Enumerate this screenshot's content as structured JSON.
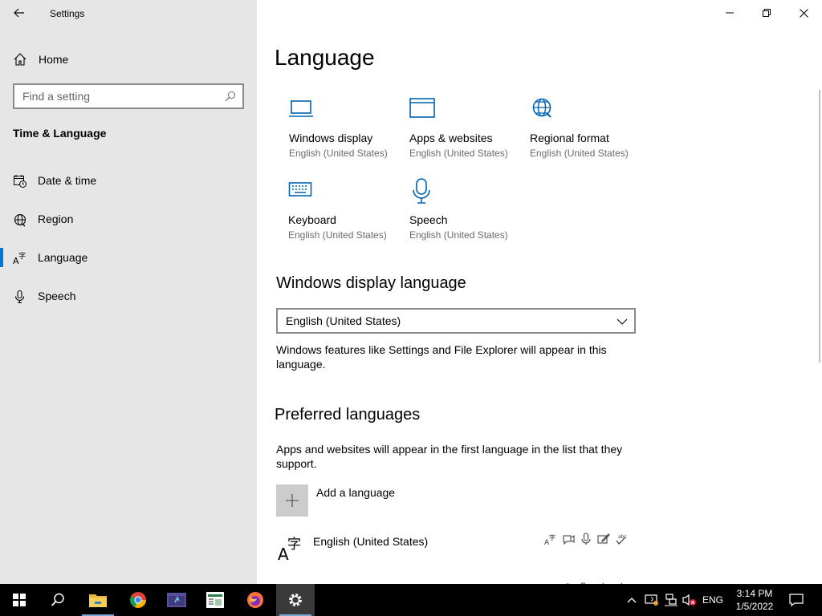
{
  "window": {
    "title": "Settings"
  },
  "nav": {
    "home_label": "Home",
    "search_placeholder": "Find a setting",
    "section_title": "Time & Language",
    "items": [
      {
        "label": "Date & time",
        "icon": "calendar-clock-icon"
      },
      {
        "label": "Region",
        "icon": "globe-icon"
      },
      {
        "label": "Language",
        "icon": "language-icon",
        "active": true
      },
      {
        "label": "Speech",
        "icon": "microphone-icon"
      }
    ]
  },
  "main": {
    "title": "Language",
    "tiles": [
      {
        "label": "Windows display",
        "sub": "English (United States)",
        "icon": "monitor-icon"
      },
      {
        "label": "Apps & websites",
        "sub": "English (United States)",
        "icon": "browser-window-icon"
      },
      {
        "label": "Regional format",
        "sub": "English (United States)",
        "icon": "globe-format-icon"
      },
      {
        "label": "Keyboard",
        "sub": "English (United States)",
        "icon": "keyboard-icon"
      },
      {
        "label": "Speech",
        "sub": "English (United States)",
        "icon": "microphone-icon"
      }
    ],
    "display_language": {
      "heading": "Windows display language",
      "selected": "English (United States)",
      "description": "Windows features like Settings and File Explorer will appear in this language."
    },
    "preferred": {
      "heading": "Preferred languages",
      "description": "Apps and websites will appear in the first language in the list that they support.",
      "add_label": "Add a language",
      "languages": [
        {
          "label": "English (United States)"
        }
      ]
    }
  },
  "taskbar": {
    "lang": "ENG",
    "time": "3:14 PM",
    "date": "1/5/2022"
  },
  "colors": {
    "accent": "#0078d7",
    "nav_bg": "#e6e6e6",
    "taskbar_bg": "#000000"
  }
}
